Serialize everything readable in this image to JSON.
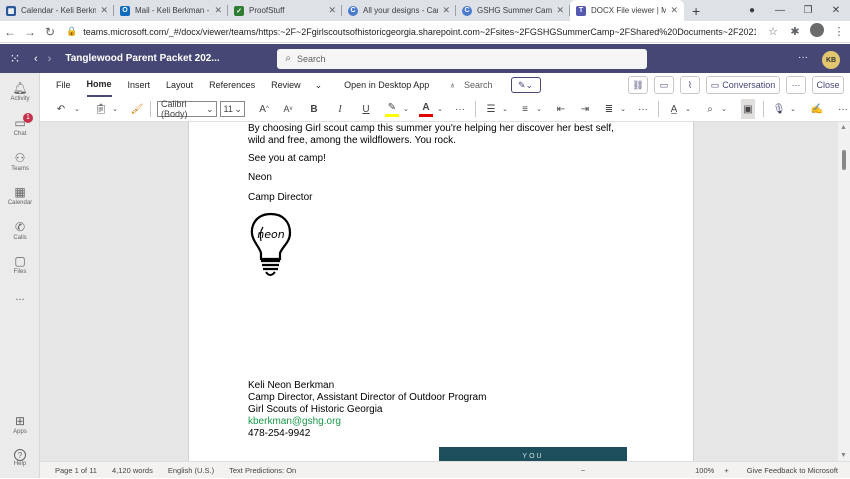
{
  "browser": {
    "tabs": [
      {
        "title": "Calendar - Keli Berkman",
        "icon": "calendar-icon",
        "color": "#2b579a",
        "glyph": "▦"
      },
      {
        "title": "Mail - Keli Berkman - C",
        "icon": "outlook-icon",
        "color": "#0f6cbd",
        "glyph": "O"
      },
      {
        "title": "ProofStuff",
        "icon": "check-icon",
        "color": "#2e7d32",
        "glyph": "✓"
      },
      {
        "title": "All your designs - Canv",
        "icon": "canva-icon",
        "color": "#4a7bd0",
        "glyph": "C"
      },
      {
        "title": "GSHG Summer Camp",
        "icon": "canva-icon",
        "color": "#4a7bd0",
        "glyph": "C"
      },
      {
        "title": "DOCX File viewer | Mic",
        "icon": "teams-icon",
        "color": "#5558af",
        "glyph": "T"
      }
    ],
    "new_tab": "+",
    "url": "teams.microsoft.com/_#/docx/viewer/teams/https:~2F~2Fgirlscoutsofhistoricgeorgia.sharepoint.com~2Fsites~2FGSHGSummerCamp~2FShared%20Documents~2F2021%20Sum..."
  },
  "teams": {
    "title": "Tanglewood Parent Packet 202...",
    "search_placeholder": "Search",
    "user_initials": "KB",
    "rail": [
      {
        "label": "Activity",
        "icon": "bell-icon",
        "glyph": "🔔"
      },
      {
        "label": "Chat",
        "icon": "chat-icon",
        "glyph": "💬",
        "badge": "1"
      },
      {
        "label": "Teams",
        "icon": "teams-icon",
        "glyph": "👥"
      },
      {
        "label": "Calendar",
        "icon": "calendar-icon",
        "glyph": "📅"
      },
      {
        "label": "Calls",
        "icon": "phone-icon",
        "glyph": "✆"
      },
      {
        "label": "Files",
        "icon": "file-icon",
        "glyph": "🗋"
      },
      {
        "label": "...",
        "icon": "more-icon",
        "glyph": ""
      },
      {
        "label": "Apps",
        "icon": "apps-icon",
        "glyph": "⊞"
      },
      {
        "label": "Help",
        "icon": "help-icon",
        "glyph": "?"
      }
    ]
  },
  "ribbon": {
    "tabs": [
      "File",
      "Home",
      "Insert",
      "Layout",
      "References",
      "Review"
    ],
    "active_tab": "Home",
    "open_desktop": "Open in Desktop App",
    "search": "Search",
    "conversation": "Conversation",
    "more": "···",
    "close": "Close",
    "font": "Calibri (Body)",
    "size": "11"
  },
  "document": {
    "paragraphs": [
      "By choosing Girl scout camp this summer you're helping her discover her best self, wild and free, among the wildflowers. You rock.",
      "See you at camp!",
      "Neon",
      "Camp Director"
    ],
    "signature": {
      "name": "Keli Neon Berkman",
      "title": "Camp Director, Assistant Director of Outdoor Program",
      "org": "Girl Scouts of Historic Georgia",
      "email": "kberkman@gshg.org",
      "phone": "478-254-9942"
    },
    "bulb_text": "neon",
    "banner_text": "YOU"
  },
  "status": {
    "page": "Page 1 of 11",
    "words": "4,120 words",
    "language": "English (U.S.)",
    "predictions": "Text Predictions: On",
    "zoom_out": "−",
    "zoom": "100%",
    "zoom_in": "+",
    "feedback": "Give Feedback to Microsoft"
  }
}
